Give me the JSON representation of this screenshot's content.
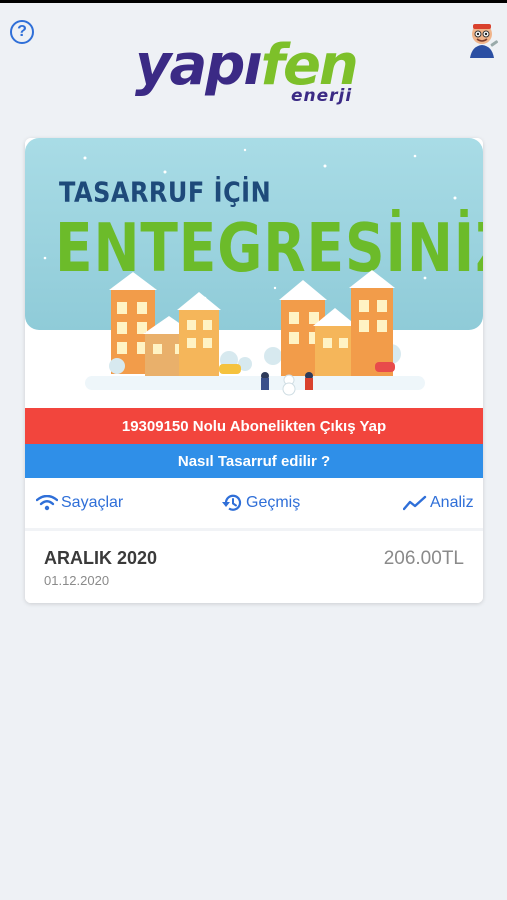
{
  "header": {
    "help_glyph": "?",
    "help_icon": "question-circle-icon",
    "mascot_icon": "mascot-avatar-icon",
    "logo": {
      "main_part1": "yapı",
      "main_part2": "fen",
      "sub": "enerji",
      "color_primary": "#3b2a85",
      "color_accent": "#7dc02a"
    }
  },
  "banner": {
    "line1": "TASARRUF İÇİN",
    "line2": "ENTEGRESİNİZ!",
    "sky_color": "#a9dce6",
    "accent_color": "#6cbb2a"
  },
  "actions": {
    "unsubscribe_label": "19309150 Nolu Abonelikten Çıkış Yap",
    "unsubscribe_color": "#f2453d",
    "howto_label": "Nasıl Tasarruf edilir ?",
    "howto_color": "#2f8fe8"
  },
  "tabs": [
    {
      "label": "Sayaçlar",
      "icon": "wifi-icon"
    },
    {
      "label": "Geçmiş",
      "icon": "history-icon"
    },
    {
      "label": "Analiz",
      "icon": "trend-icon"
    }
  ],
  "bills": [
    {
      "month": "ARALIK 2020",
      "date": "01.12.2020",
      "amount": "206.00TL"
    }
  ],
  "accent_color": "#2f6fd8"
}
